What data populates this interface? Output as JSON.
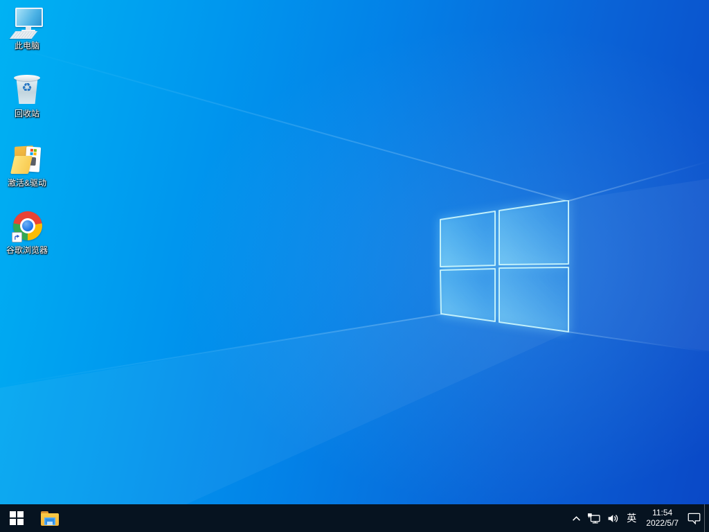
{
  "desktop": {
    "icons": [
      {
        "id": "this-pc",
        "label": "此电脑"
      },
      {
        "id": "recycle-bin",
        "label": "回收站"
      },
      {
        "id": "activation-drivers",
        "label": "激活&驱动"
      },
      {
        "id": "google-chrome",
        "label": "谷歌浏览器"
      }
    ],
    "recycle_glyph": "♻"
  },
  "wallpaper": {
    "logo": "windows-flag",
    "colors": {
      "light": "#00b2f3",
      "mid": "#0381e7",
      "dark": "#0a47c6",
      "pane_edge": "#c9f4fb"
    }
  },
  "taskbar": {
    "background": "#061320",
    "icons": {
      "start": "windows-logo-icon",
      "file_explorer": "folder-icon",
      "tray_expand": "chevron-up-icon",
      "network": "network-ethernet-icon",
      "volume": "speaker-icon",
      "action_center": "speech-bubble-icon"
    },
    "tray": {
      "ime_label": "英"
    },
    "clock": {
      "time": "11:54",
      "date": "2022/5/7"
    }
  }
}
